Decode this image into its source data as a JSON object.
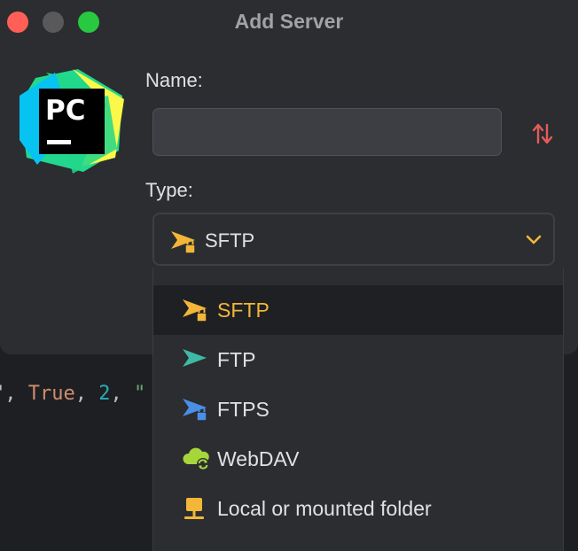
{
  "dialog": {
    "title": "Add Server",
    "logo_text": "PC",
    "name_label": "Name:",
    "name_value": "",
    "type_label": "Type:",
    "selected_type": "SFTP"
  },
  "dropdown": {
    "options": [
      {
        "label": "SFTP",
        "icon": "sftp-send-lock-icon",
        "selected": true
      },
      {
        "label": "FTP",
        "icon": "ftp-send-icon"
      },
      {
        "label": "FTPS",
        "icon": "ftps-send-lock-icon"
      },
      {
        "label": "WebDAV",
        "icon": "cloud-sync-icon"
      },
      {
        "label": "Local or mounted folder",
        "icon": "network-drive-icon"
      }
    ]
  },
  "background_code": {
    "prefix": "\", ",
    "kw": "True",
    "sep1": ", ",
    "num": "2",
    "sep2": ", ",
    "str": "\""
  },
  "colors": {
    "accent_orange": "#f2b738",
    "ftp_teal": "#3fb8a5",
    "ftps_blue": "#4a8fe6",
    "webdav_green": "#a7d63b",
    "sort_red": "#e55b5b"
  }
}
